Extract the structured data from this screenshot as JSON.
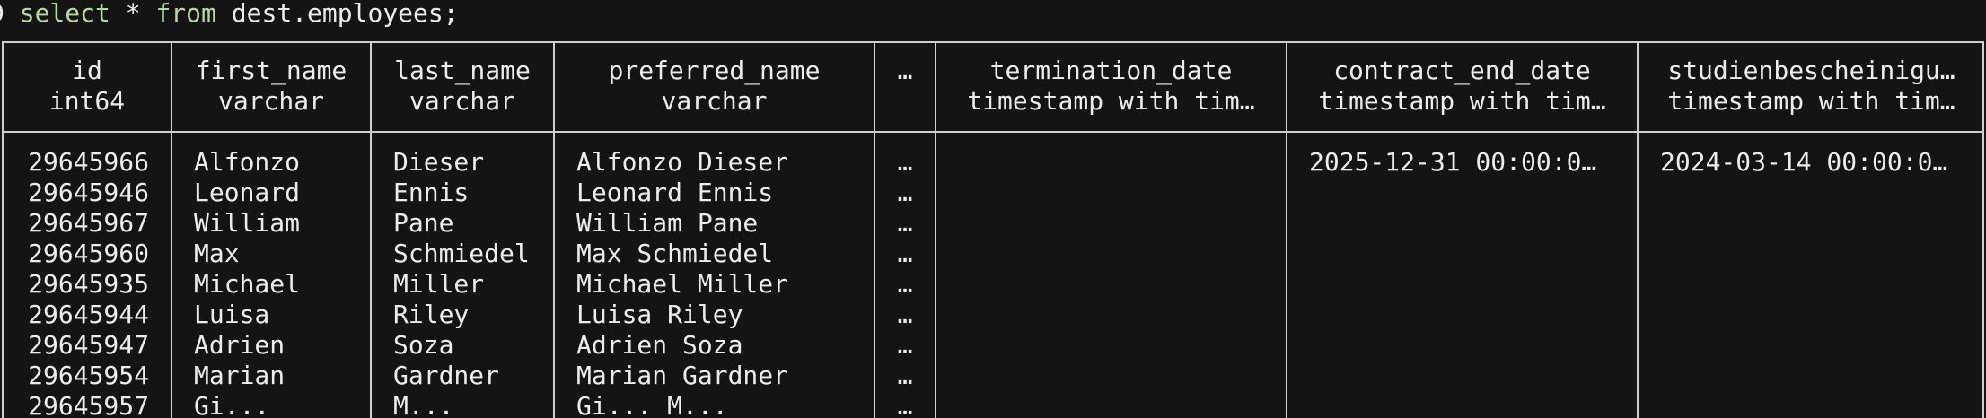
{
  "prompt": {
    "marker": "D",
    "keyword_select": "select",
    "star": " * ",
    "keyword_from": "from",
    "table_ref": " dest.employees;"
  },
  "columns": [
    {
      "name": "id",
      "type": "int64"
    },
    {
      "name": "first_name",
      "type": "varchar"
    },
    {
      "name": "last_name",
      "type": "varchar"
    },
    {
      "name": "preferred_name",
      "type": "varchar"
    },
    {
      "name": "…",
      "type": ""
    },
    {
      "name": "termination_date",
      "type": "timestamp with tim…"
    },
    {
      "name": "contract_end_date",
      "type": "timestamp with tim…"
    },
    {
      "name": "studienbescheinigu…",
      "type": "timestamp with tim…"
    }
  ],
  "rows": {
    "id": [
      "29645966",
      "29645946",
      "29645967",
      "29645960",
      "29645935",
      "29645944",
      "29645947",
      "29645954",
      "29645957"
    ],
    "first_name": [
      "Alfonzo",
      "Leonard",
      "William",
      "Max",
      "Michael",
      "Luisa",
      "Adrien",
      "Marian",
      "Gi..."
    ],
    "last_name": [
      "Dieser",
      "Ennis",
      "Pane",
      "Schmiedel",
      "Miller",
      "Riley",
      "Soza",
      "Gardner",
      "M..."
    ],
    "preferred_name": [
      "Alfonzo Dieser",
      "Leonard Ennis",
      "William Pane",
      "Max Schmiedel",
      "Michael Miller",
      "Luisa Riley",
      "Adrien Soza",
      "Marian Gardner",
      "Gi... M..."
    ],
    "ellipsis": [
      "…",
      "…",
      "…",
      "…",
      "…",
      "…",
      "…",
      "…",
      "…"
    ],
    "termination_date": [
      "",
      "",
      "",
      "",
      "",
      "",
      "",
      "",
      ""
    ],
    "contract_end_date": [
      "2025-12-31 00:00:0…",
      "",
      "",
      "",
      "",
      "",
      "",
      "",
      ""
    ],
    "studienbescheinigung": [
      "2024-03-14 00:00:0…",
      "",
      "",
      "",
      "",
      "",
      "",
      "",
      ""
    ]
  }
}
